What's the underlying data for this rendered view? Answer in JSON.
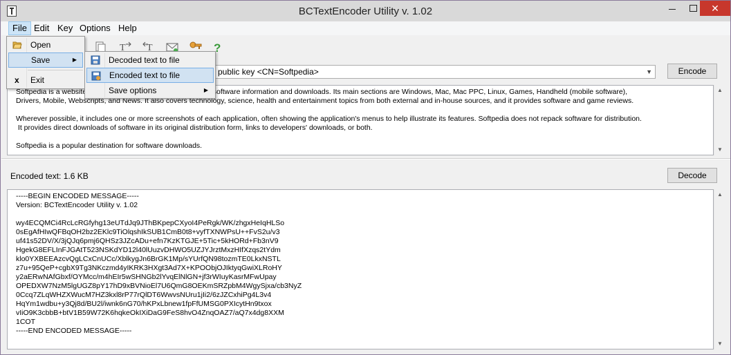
{
  "window": {
    "title": "BCTextEncoder Utility v. 1.02",
    "minimize": "",
    "maximize": "",
    "close": "✕"
  },
  "menubar": {
    "items": [
      "File",
      "Edit",
      "Key",
      "Options",
      "Help"
    ],
    "active": "File"
  },
  "file_menu": {
    "open": "Open",
    "save": "Save",
    "exit": "Exit",
    "exit_icon": "x"
  },
  "save_submenu": {
    "decoded": "Decoded text to file",
    "encoded": "Encoded text to file",
    "options": "Save options"
  },
  "encrypt": {
    "key_selected": "public key <CN=Softpedia>",
    "encode_label": "Encode"
  },
  "plain_text": "Softpedia is a website                                                  rimarily software information and downloads. Its main sections are Windows, Mac, Mac PPC, Linux, Games, Handheld (mobile software),\nDrivers, Mobile, Webscripts, and News. It also covers technology, science, health and entertainment topics from both external and in-house sources, and it provides software and game reviews.\n\nWherever possible, it includes one or more screenshots of each application, often showing the application's menus to help illustrate its features. Softpedia does not repack software for distribution.\n It provides direct downloads of software in its original distribution form, links to developers' downloads, or both.\n\nSoftpedia is a popular destination for software downloads.",
  "encoded": {
    "label": "Encoded text: 1.6 KB",
    "decode_label": "Decode",
    "text": "-----BEGIN ENCODED MESSAGE-----\nVersion: BCTextEncoder Utility v. 1.02\n\nwy4ECQMCi4RcLcRGfyhg13eUTdJq9JThBKpepCXyoI4PeRgk/WK/zhgxHeIqHLSo\n0sEgAfHIwQFBqOH2bz2EKlc9TiOlqshIkSUB1CmB0t8+vyfTXNWPsU++FvS2u/v3\nuf41s52DV/X/3jQJq6pmj6QHSz3JZcADu+efn7KzKTGJE+5Tic+5kHORd+Fb3nV9\nHgekG8EFLInFJGAtT523NSKdYD12l40lUuzvDHWO5UZJYJrztMxzHIfXzqs2tYdm\nklo0YXBEEAzcvQgLCxCnUCc/XblkygJn6BrGK1Mp/sYUrfQN98tozmTE0LkxNSTL\nz7u+95QeP+cgbX9Tg3NKczmd4yIKRK3HXgt3Ad7X+KPOObjOJIktyqGwiXLRoHY\ny2aERwNAfGbxf/OYMcc/m4hEIr5wSHNGb2lYvqElNlGN+jf3rWIuyKasrMFwUpay\nOPEDXW7NzM5lgUGZ8pY17hD9xBVNioEl7U6QmG8OEKmSRZpbM4WgySjxa/cb3NyZ\n0Ccq7ZLqWHZXWucM7HZ3kxl8rP77rQlDT6WwvsNUru1jIi2/6zJZCxhiPg4L3v4\nHqYm1wdbu+y3Qj8d/BU2l/iwnk6nG70/hKPxLbnew1fpFfUMSG0PXIcytHn9txox\nvIiO9K3cbbB+btV1B59W72K6hqkeOkIXiDaG9FeS8hvO4ZnqOAZ7/aQ7x4dg8XXM\n1COT\n-----END ENCODED MESSAGE-----"
  },
  "icons": {
    "app": "text-encoder-app-icon",
    "open": "folder-open-icon",
    "toolbar": [
      "open-icon",
      "save-icon",
      "copy-icon",
      "encode-icon",
      "decode-icon",
      "mail-icon",
      "key-icon",
      "help-icon"
    ]
  },
  "colors": {
    "close_button": "#c7372c",
    "menu_highlight": "#cce4f7",
    "submenu_highlight": "#d1e2f2"
  }
}
